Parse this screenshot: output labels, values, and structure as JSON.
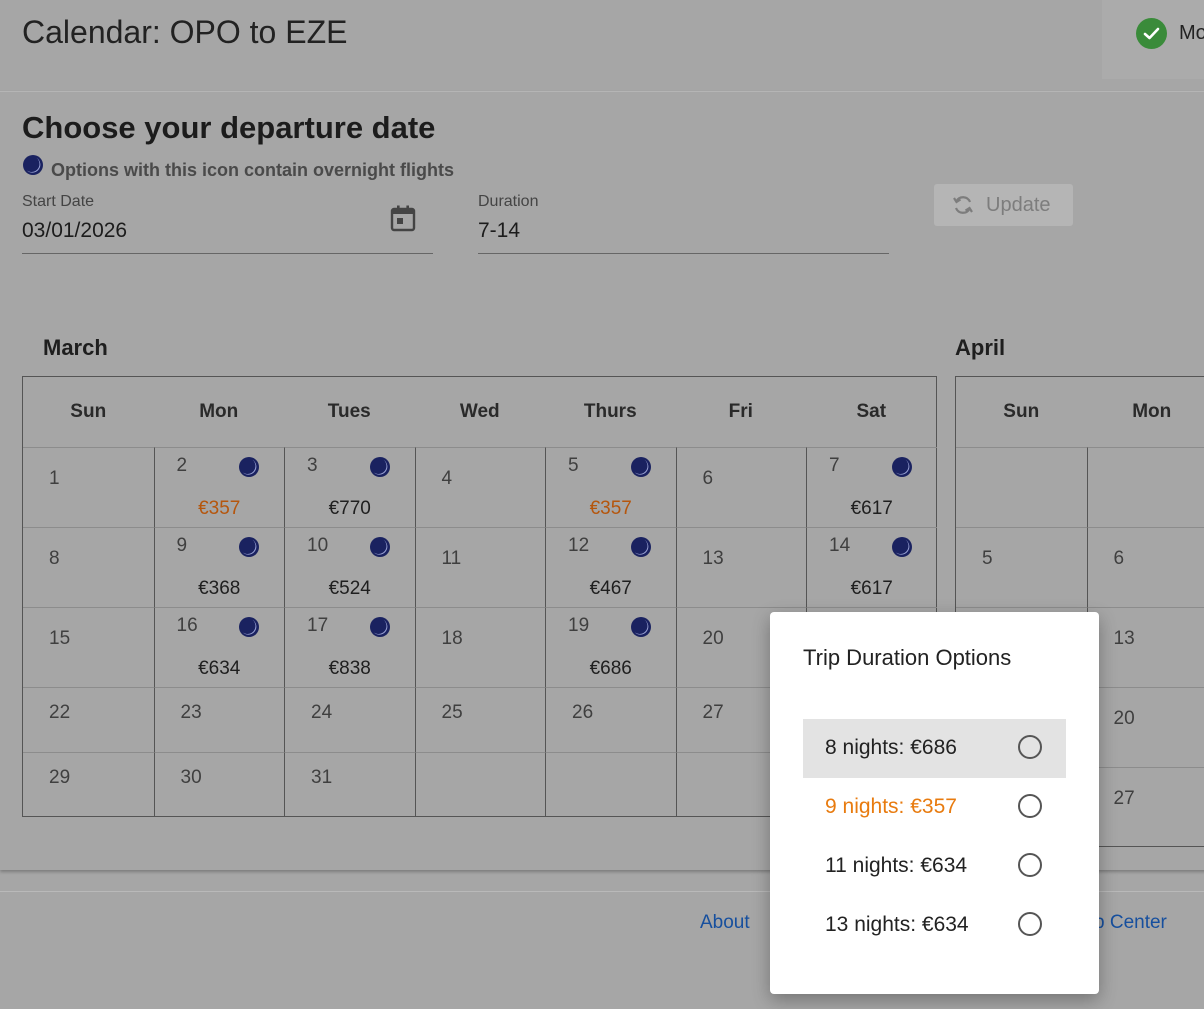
{
  "header": {
    "title": "Calendar: OPO to EZE",
    "status_text": "Mo"
  },
  "search": {
    "section_title": "Choose your departure date",
    "overnight_legend": "Options with this icon contain overnight flights",
    "start_date_label": "Start Date",
    "start_date_value": "03/01/2026",
    "duration_label": "Duration",
    "duration_value": "7-14",
    "update_label": "Update"
  },
  "march": {
    "name": "March",
    "weekdays": [
      "Sun",
      "Mon",
      "Tues",
      "Wed",
      "Thurs",
      "Fri",
      "Sat"
    ],
    "weeks": [
      [
        {
          "day": "1"
        },
        {
          "day": "2",
          "price": "€357",
          "overnight": true,
          "cheapest": true
        },
        {
          "day": "3",
          "price": "€770",
          "overnight": true
        },
        {
          "day": "4"
        },
        {
          "day": "5",
          "price": "€357",
          "overnight": true,
          "cheapest": true
        },
        {
          "day": "6"
        },
        {
          "day": "7",
          "price": "€617",
          "overnight": true
        }
      ],
      [
        {
          "day": "8"
        },
        {
          "day": "9",
          "price": "€368",
          "overnight": true
        },
        {
          "day": "10",
          "price": "€524",
          "overnight": true
        },
        {
          "day": "11"
        },
        {
          "day": "12",
          "price": "€467",
          "overnight": true
        },
        {
          "day": "13"
        },
        {
          "day": "14",
          "price": "€617",
          "overnight": true
        }
      ],
      [
        {
          "day": "15"
        },
        {
          "day": "16",
          "price": "€634",
          "overnight": true
        },
        {
          "day": "17",
          "price": "€838",
          "overnight": true
        },
        {
          "day": "18"
        },
        {
          "day": "19",
          "price": "€686",
          "overnight": true
        },
        {
          "day": "20"
        },
        {
          "day": ""
        }
      ],
      [
        {
          "day": "22"
        },
        {
          "day": "23"
        },
        {
          "day": "24"
        },
        {
          "day": "25"
        },
        {
          "day": "26"
        },
        {
          "day": "27"
        },
        {
          "day": ""
        }
      ],
      [
        {
          "day": "29"
        },
        {
          "day": "30"
        },
        {
          "day": "31"
        },
        {
          "day": ""
        },
        {
          "day": ""
        },
        {
          "day": ""
        },
        {
          "day": ""
        }
      ]
    ]
  },
  "april": {
    "name": "April",
    "weekdays": [
      "Sun",
      "Mon"
    ],
    "weeks": [
      [
        {
          "day": ""
        },
        {
          "day": ""
        }
      ],
      [
        {
          "day": "5"
        },
        {
          "day": "6"
        }
      ],
      [
        {
          "day": ""
        },
        {
          "day": "13"
        }
      ],
      [
        {
          "day": ""
        },
        {
          "day": "20"
        }
      ],
      [
        {
          "day": ""
        },
        {
          "day": "27"
        }
      ]
    ]
  },
  "footer": {
    "about": "About",
    "help_center": "p Center"
  },
  "popup": {
    "title": "Trip Duration Options",
    "options": [
      {
        "label": "8 nights: €686",
        "selected_highlight": true,
        "cheapest": false
      },
      {
        "label": "9 nights: €357",
        "selected_highlight": false,
        "cheapest": true
      },
      {
        "label": "11 nights: €634",
        "selected_highlight": false,
        "cheapest": false
      },
      {
        "label": "13 nights: €634",
        "selected_highlight": false,
        "cheapest": false
      }
    ]
  },
  "colors": {
    "cheapest_price": "#b5560d",
    "cheapest_option": "#e87b0f",
    "overnight_moon": "#1a2260",
    "success_check": "#3a8b3a",
    "link": "#164f9e"
  },
  "icons": {
    "overnight": "moon-icon",
    "date_picker": "calendar-icon",
    "update": "refresh-icon",
    "status": "check-circle-icon"
  }
}
